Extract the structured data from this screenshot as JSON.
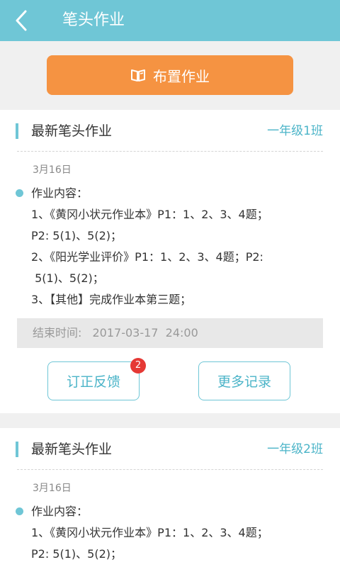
{
  "header": {
    "title": "笔头作业",
    "back_icon": "chevron-left-icon"
  },
  "assign_button": {
    "label": "布置作业",
    "icon": "book-icon"
  },
  "cards": [
    {
      "title": "最新笔头作业",
      "class_name": "一年级1班",
      "date": "3月16日",
      "content_lines": [
        "作业内容：",
        "1、《黄冈小状元作业本》P1：1、2、3、4题；",
        "P2: 5(1)、5(2)；",
        "2、《阳光学业评价》P1：1、2、3、4题；P2:",
        " 5(1)、5(2)；",
        "3、【其他】完成作业本第三题；"
      ],
      "end_time_label": "结束时间:",
      "end_time_value": "2017-03-17  24:00",
      "correct_button": "订正反馈",
      "correct_badge": "2",
      "more_button": "更多记录"
    },
    {
      "title": "最新笔头作业",
      "class_name": "一年级2班",
      "date": "3月16日",
      "content_lines": [
        "作业内容：",
        "1、《黄冈小状元作业本》P1：1、2、3、4题；",
        "P2: 5(1)、5(2)；"
      ]
    }
  ],
  "colors": {
    "header": "#6fc6d6",
    "accent_orange": "#f59342",
    "accent_teal": "#4bb4c8",
    "badge_red": "#e53935"
  }
}
